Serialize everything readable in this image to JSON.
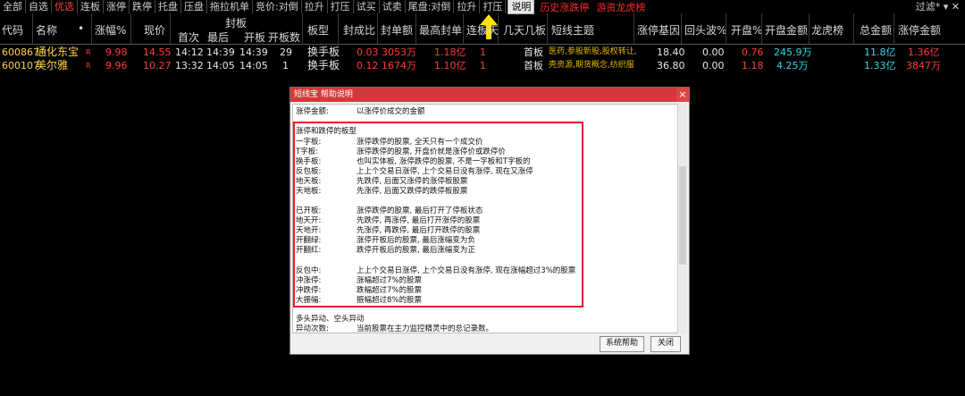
{
  "toolbar": {
    "items": [
      "全部",
      "自选",
      "优选",
      "连板",
      "涨停",
      "跌停",
      "托盘",
      "压盘",
      "拖拉机单",
      "竞价:对倒",
      "拉升",
      "打压",
      "试买",
      "试卖",
      "尾盘:对倒",
      "拉升",
      "打压"
    ],
    "help_button": "说明",
    "history_link": "历史涨跌停",
    "dragon_link": "游资龙虎榜",
    "filter_label": "过滤*"
  },
  "header": {
    "code": "代码",
    "name": "名称",
    "dot": "•",
    "pct": "涨幅%",
    "price": "现价",
    "fengban": "封板",
    "first": "首次",
    "last": "最后",
    "open_board": "开板",
    "open_count": "开板数",
    "board_type": "板型",
    "seal_ratio": "封成比",
    "seal_amount": "封单额",
    "max_seal": "最高封单",
    "lianban": "连板天",
    "jitian": "几天几板",
    "theme": "短线主题",
    "base": "涨停基因",
    "pullback": "回头波%",
    "open_pct": "开盘%",
    "open_amount": "开盘金额",
    "dragon": "龙虎榜",
    "total_amount": "总金额",
    "limit_amount": "涨停金额"
  },
  "rows": [
    {
      "code": "600867",
      "name": "通化东宝",
      "flag": "R",
      "pct": "9.98",
      "price": "14.55",
      "first": "14:12",
      "last": "14:39",
      "open_board": "14:39",
      "open_count": "29",
      "type": "换手板",
      "seal_ratio": "0.03",
      "seal_amount": "3053万",
      "max_seal": "1.18亿",
      "lianban": "1",
      "jitian": "首板",
      "theme": "医药,参股新股,股权转让,",
      "base": "18.40",
      "pullback": "0.00",
      "open_pct": "0.76",
      "open_amount": "245.9万",
      "total": "11.8亿",
      "limit_amount": "1.36亿"
    },
    {
      "code": "600107",
      "name": "美尔雅",
      "flag": "R",
      "pct": "9.96",
      "price": "10.27",
      "first": "13:32",
      "last": "14:05",
      "open_board": "14:05",
      "open_count": "1",
      "type": "换手板",
      "seal_ratio": "0.12",
      "seal_amount": "1674万",
      "max_seal": "1.10亿",
      "lianban": "1",
      "jitian": "首板",
      "theme": "壳资源,期货概念,纺织服",
      "base": "36.80",
      "pullback": "0.00",
      "open_pct": "1.18",
      "open_amount": "4.25万",
      "total": "1.33亿",
      "limit_amount": "3847万"
    }
  ],
  "dialog": {
    "title": "短线宝 帮助说明",
    "close": "×",
    "line0_term": "涨停金额:",
    "line0_desc": "以涨停价成交的金额",
    "section_title": "涨停和跌停的板型",
    "items": [
      {
        "term": "一字板:",
        "desc": "涨停跌停的股票, 全天只有一个成交价"
      },
      {
        "term": "T字板:",
        "desc": "涨停跌停的股票, 开盘价就是涨停价或跌停价"
      },
      {
        "term": "换手板:",
        "desc": "也叫实体板, 涨停跌停的股票, 不是一字板和T字板的"
      },
      {
        "term": "反包板:",
        "desc": "上上个交易日涨停, 上个交易日没有涨停, 现在又涨停"
      },
      {
        "term": "地天板:",
        "desc": "先跌停, 后面又涨停的涨停板股票"
      },
      {
        "term": "天地板:",
        "desc": "先涨停, 后面又跌停的跌停板股票"
      },
      {
        "term": "已开板:",
        "desc": "涨停跌停的股票, 最后打开了停板状态"
      },
      {
        "term": "地天开:",
        "desc": "先跌停, 再涨停, 最后打开涨停的股票"
      },
      {
        "term": "天地开:",
        "desc": "先涨停, 再跌停, 最后打开跌停的股票"
      },
      {
        "term": "开翻绿:",
        "desc": "涨停开板后的股票, 最后涨幅变为负"
      },
      {
        "term": "开翻红:",
        "desc": "跌停开板后的股票, 最后涨幅变为正"
      },
      {
        "term": "反包中:",
        "desc": "上上个交易日涨停, 上个交易日没有涨停, 现在涨幅超过3%的股票"
      },
      {
        "term": "冲涨停:",
        "desc": "涨幅超过7%的股票"
      },
      {
        "term": "冲跌停:",
        "desc": "跌幅超过7%的股票"
      },
      {
        "term": "大振幅:",
        "desc": "振幅超过8%的股票"
      }
    ],
    "footer_title": "多头异动、空头异动",
    "footer_term": "异动次数:",
    "footer_desc": "当前股票在主力监控精灵中的总记录数。",
    "help_btn": "系统帮助",
    "close_btn": "关闭"
  },
  "colors": {
    "accent_red": "#ff3b3b",
    "yellow": "#ffd24a",
    "cyan": "#34d8e8",
    "dialog_title": "#d23a3a"
  }
}
